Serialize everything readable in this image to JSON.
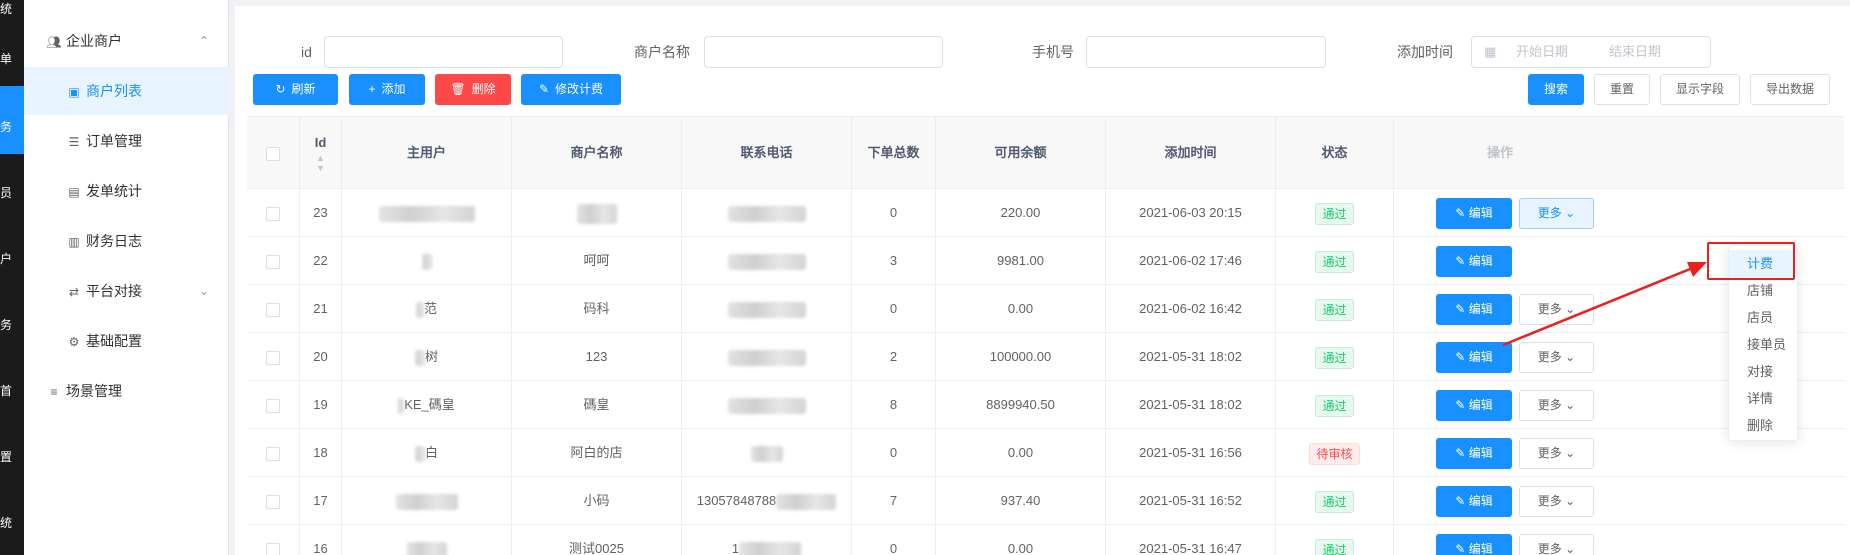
{
  "left_strip": {
    "labels": [
      "统",
      "单",
      "务",
      "员",
      "户",
      "务",
      "首",
      "置",
      "统"
    ]
  },
  "sidebar": {
    "items": [
      {
        "label": "企业商户",
        "icon": "users-icon",
        "arrow": "chevron-up-icon"
      },
      {
        "label": "商户列表",
        "icon": "user-card-icon",
        "active": true
      },
      {
        "label": "订单管理",
        "icon": "document-icon"
      },
      {
        "label": "发单统计",
        "icon": "chart-icon"
      },
      {
        "label": "财务日志",
        "icon": "log-icon"
      },
      {
        "label": "平台对接",
        "icon": "swap-icon",
        "arrow": "chevron-down-icon"
      },
      {
        "label": "基础配置",
        "icon": "gear-icon"
      },
      {
        "label": "场景管理",
        "icon": "list-icon"
      }
    ]
  },
  "search": {
    "id_label": "id",
    "name_label": "商户名称",
    "phone_label": "手机号",
    "time_label": "添加时间",
    "start_placeholder": "开始日期",
    "end_placeholder": "结束日期"
  },
  "toolbar": {
    "refresh": "刷新",
    "add": "添加",
    "delete": "删除",
    "edit_fee": "修改计费",
    "search": "搜索",
    "reset": "重置",
    "show_fields": "显示字段",
    "export": "导出数据"
  },
  "table": {
    "headers": {
      "id": "Id",
      "main_user": "主用户",
      "merchant_name": "商户名称",
      "phone": "联系电话",
      "order_total": "下单总数",
      "balance": "可用余额",
      "added_time": "添加时间",
      "status": "状态",
      "actions": "操作"
    },
    "edit_label": "编辑",
    "more_label": "更多",
    "rows": [
      {
        "id": "23",
        "main_user": "",
        "merchant_name": "",
        "phone": "",
        "orders": "0",
        "balance": "220.00",
        "time": "2021-06-03 20:15",
        "status": "通过",
        "status_type": "ok"
      },
      {
        "id": "22",
        "main_user": "",
        "merchant_name": "呵呵",
        "phone": "",
        "orders": "3",
        "balance": "9981.00",
        "time": "2021-06-02 17:46",
        "status": "通过",
        "status_type": "ok"
      },
      {
        "id": "21",
        "main_user": "范",
        "merchant_name": "码科",
        "phone": "",
        "orders": "0",
        "balance": "0.00",
        "time": "2021-06-02 16:42",
        "status": "通过",
        "status_type": "ok"
      },
      {
        "id": "20",
        "main_user": "树",
        "merchant_name": "123",
        "phone": "",
        "orders": "2",
        "balance": "100000.00",
        "time": "2021-05-31 18:02",
        "status": "通过",
        "status_type": "ok"
      },
      {
        "id": "19",
        "main_user": "KE_碼皇",
        "merchant_name": "碼皇",
        "phone": "",
        "orders": "8",
        "balance": "8899940.50",
        "time": "2021-05-31 18:02",
        "status": "通过",
        "status_type": "ok"
      },
      {
        "id": "18",
        "main_user": "白",
        "merchant_name": "阿白的店",
        "phone": "",
        "orders": "0",
        "balance": "0.00",
        "time": "2021-05-31 16:56",
        "status": "待审核",
        "status_type": "wait"
      },
      {
        "id": "17",
        "main_user": "",
        "merchant_name": "小码",
        "phone": "13057848788",
        "orders": "7",
        "balance": "937.40",
        "time": "2021-05-31 16:52",
        "status": "通过",
        "status_type": "ok"
      },
      {
        "id": "16",
        "main_user": "",
        "merchant_name": "测试0025",
        "phone": "1",
        "orders": "0",
        "balance": "0.00",
        "time": "2021-05-31 16:47",
        "status": "通过",
        "status_type": "ok"
      }
    ]
  },
  "dropdown": {
    "items": [
      "计费",
      "店铺",
      "店员",
      "接单员",
      "对接",
      "详情",
      "删除"
    ]
  },
  "colors": {
    "primary": "#1890ff",
    "danger": "#ff4949",
    "success": "#13ce66",
    "annotation": "#e8211d"
  }
}
